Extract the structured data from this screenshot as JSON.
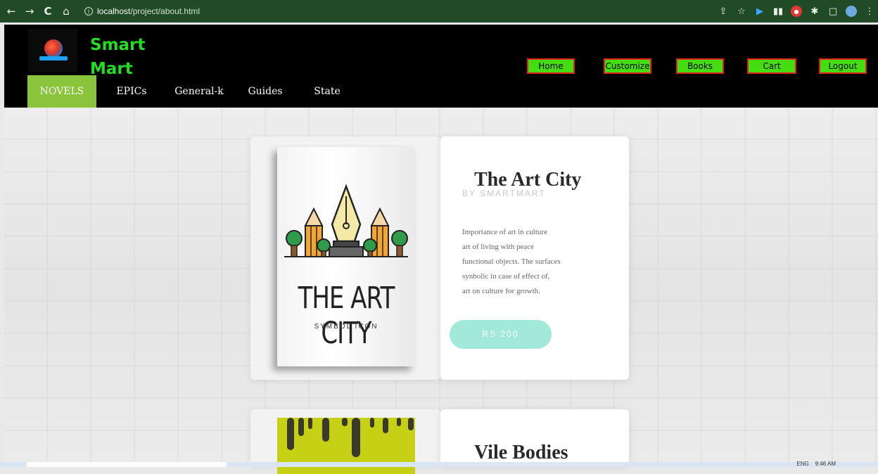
{
  "browser": {
    "back_icon": "←",
    "forward_icon": "→",
    "reload_icon": "C",
    "home_icon": "⌂",
    "url_host": "localhost",
    "url_path": "/project/about.html"
  },
  "site": {
    "brand_line1": "Smart",
    "brand_line2": "Mart",
    "top_nav": [
      "Home",
      "Customize",
      "Books",
      "Cart",
      "Logout"
    ],
    "categories": [
      "NOVELS",
      "EPICs",
      "General-k",
      "Guides",
      "State"
    ],
    "active_category": "NOVELS"
  },
  "products": [
    {
      "title": "The Art City",
      "byline": "BY SMARTMART",
      "description": [
        "Importance of art in culture",
        "art of living with peace",
        "functional objects. The surfaces",
        "synbolic in case of effect of,",
        "art on culture for growth."
      ],
      "price_label": "RS 200",
      "cover_title": "THE ART CITY",
      "cover_subtitle": "SYMBOL ICON"
    },
    {
      "title": "Vile Bodies"
    }
  ],
  "taskbar": {
    "lang": "ENG",
    "time": "9:46 AM"
  },
  "colors": {
    "chrome": "#214a26",
    "brand_green": "#22dd22",
    "nav_button": "#44dd11",
    "nav_border": "#e0221c",
    "active_tab": "#89c43a",
    "price_button": "#a3e9d9"
  }
}
